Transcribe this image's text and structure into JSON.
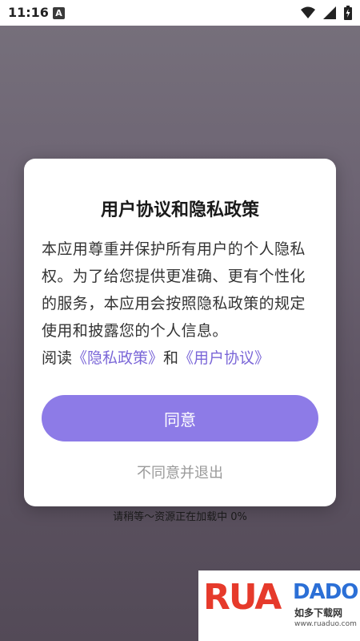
{
  "status_bar": {
    "time": "11:16",
    "badge": "A"
  },
  "dialog": {
    "title": "用户协议和隐私政策",
    "body": "本应用尊重并保护所有用户的个人隐私权。为了给您提供更准确、更有个性化的服务，本应用会按照隐私政策的规定使用和披露您的个人信息。",
    "read_prefix": "阅读",
    "privacy_link": "《隐私政策》",
    "and_text": "和",
    "user_agreement_link": "《用户协议》",
    "agree_label": "同意",
    "disagree_label": "不同意并退出"
  },
  "loading_text": "请稍等～资源正在加载中 0%",
  "watermark": {
    "logo_part1": "RUA",
    "logo_part2": "DADO",
    "cn_name": "如多下载网",
    "url": "www.ruaduo.com"
  },
  "colors": {
    "accent": "#8d7be7",
    "link": "#7b67d8",
    "background": "#5f5463"
  }
}
